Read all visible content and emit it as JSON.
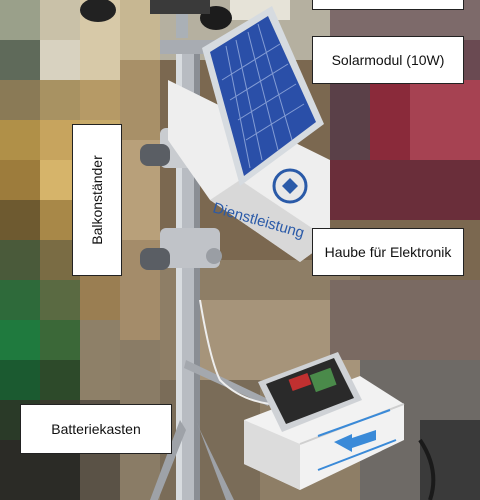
{
  "labels": {
    "solar_module": "Solarmodul (10W)",
    "stand": "Balkonständer",
    "electronics_cover": "Haube für Elektronik",
    "battery_box": "Batteriekasten",
    "box_text": "Dienstleistung"
  },
  "colors": {
    "label_bg": "#ffffff",
    "solar_panel": "#2a4fa8",
    "pole": "#b8bcc2",
    "enclosure_arrow": "#3a8ad8"
  },
  "icons": {
    "solar": "solar-panel",
    "anemometer": "anemometer-cups",
    "cover": "electronics-cover",
    "battery": "battery-enclosure"
  }
}
